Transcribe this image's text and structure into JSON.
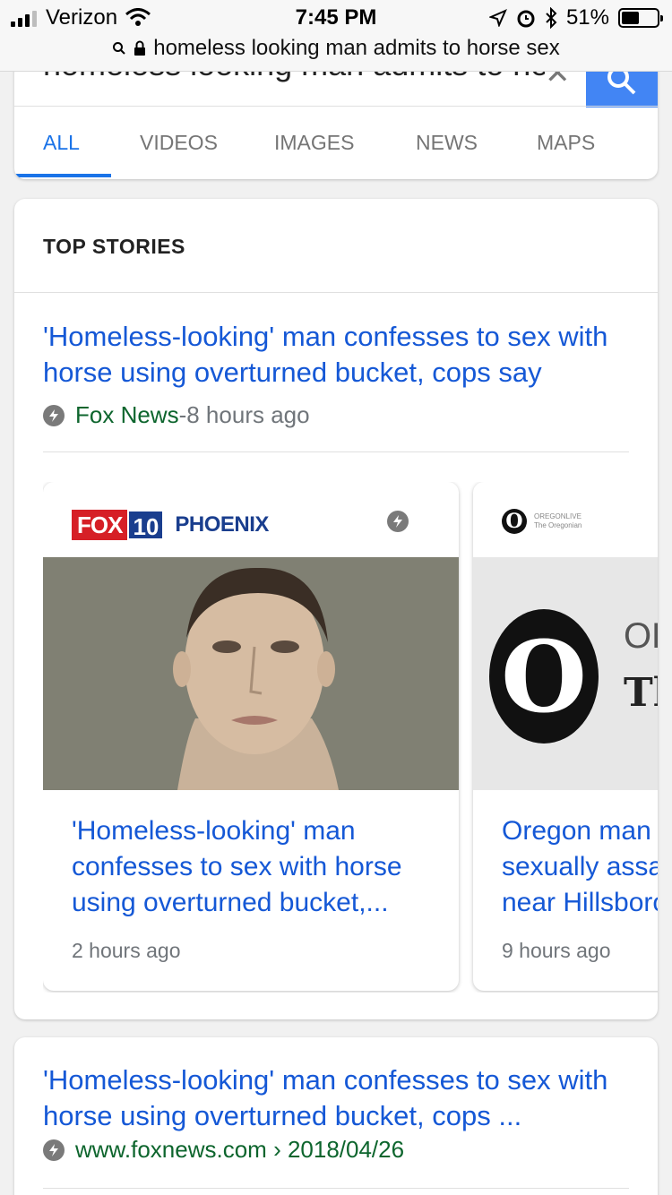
{
  "status_bar": {
    "carrier": "Verizon",
    "time": "7:45 PM",
    "battery": "51%",
    "battery_level": 0.51,
    "url": "homeless looking man admits to horse sex"
  },
  "search": {
    "query": "homeless looking man admits to horse sex",
    "tabs": [
      "ALL",
      "VIDEOS",
      "IMAGES",
      "NEWS",
      "MAPS"
    ],
    "active_tab": "ALL"
  },
  "top_stories": {
    "title": "TOP STORIES",
    "lead": {
      "headline": "'Homeless-looking' man confesses to sex with horse using overturned bucket, cops say",
      "source": "Fox News",
      "separator": " - ",
      "time": "8 hours ago"
    },
    "cards": [
      {
        "publisher_logo_text": [
          "FOX",
          "10",
          "PHOENIX"
        ],
        "title": "'Homeless-looking' man confesses to sex with horse using overturned bucket,...",
        "time": "2 hours ago"
      },
      {
        "publisher_logo_text": [
          "OREGONLIVE",
          "The Oregonian",
          "OR",
          "Th"
        ],
        "title": "Oregon man sexually assa near Hillsboro",
        "title_visible": [
          "Oregon man",
          "sexually assa",
          "near Hillsboro"
        ],
        "time": "9 hours ago"
      }
    ]
  },
  "result": {
    "title": "'Homeless-looking' man confesses to sex with horse using overturned bucket, cops ...",
    "url": "www.foxnews.com › 2018/04/26"
  },
  "colors": {
    "link": "#1558d6",
    "source_green": "#0d652d",
    "accent_blue": "#4285f4",
    "fox_red": "#d61f26",
    "fox_blue": "#1a3e8e"
  }
}
